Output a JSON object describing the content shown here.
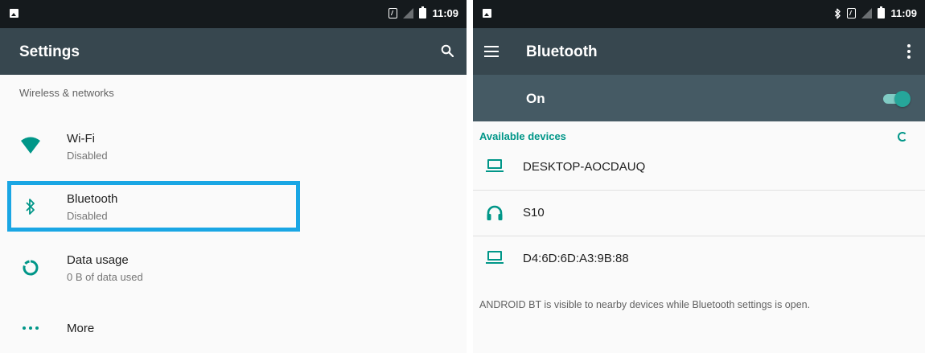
{
  "colors": {
    "toolbar": "#37474f",
    "statusbar": "#151a1d",
    "accent": "#009688",
    "highlight": "#1aa6e4",
    "on_bar": "#455a64"
  },
  "left": {
    "status": {
      "time": "11:09",
      "icons": [
        "image-icon",
        "nfc-icon",
        "signal-off-icon",
        "battery-icon"
      ]
    },
    "toolbar": {
      "title": "Settings",
      "action_icon": "search-icon"
    },
    "section_header": "Wireless & networks",
    "items": [
      {
        "label": "Wi-Fi",
        "summary": "Disabled",
        "icon": "wifi-icon"
      },
      {
        "label": "Bluetooth",
        "summary": "Disabled",
        "icon": "bluetooth-icon"
      },
      {
        "label": "Data usage",
        "summary": "0 B of data used",
        "icon": "data-usage-icon"
      },
      {
        "label": "More",
        "summary": "",
        "icon": "more-icon"
      }
    ]
  },
  "right": {
    "status": {
      "time": "11:09",
      "icons": [
        "image-icon",
        "bluetooth-icon",
        "nfc-icon",
        "signal-off-icon",
        "battery-icon"
      ]
    },
    "toolbar": {
      "title": "Bluetooth",
      "nav_icon": "menu-icon",
      "action_icon": "overflow-icon"
    },
    "switch": {
      "label": "On",
      "checked": true
    },
    "available_header": "Available devices",
    "devices": [
      {
        "name": "DESKTOP-AOCDAUQ",
        "icon": "laptop-icon"
      },
      {
        "name": "S10",
        "icon": "headphones-icon"
      },
      {
        "name": "D4:6D:6D:A3:9B:88",
        "icon": "laptop-icon"
      }
    ],
    "footer": "ANDROID BT is visible to nearby devices while Bluetooth settings is open."
  }
}
